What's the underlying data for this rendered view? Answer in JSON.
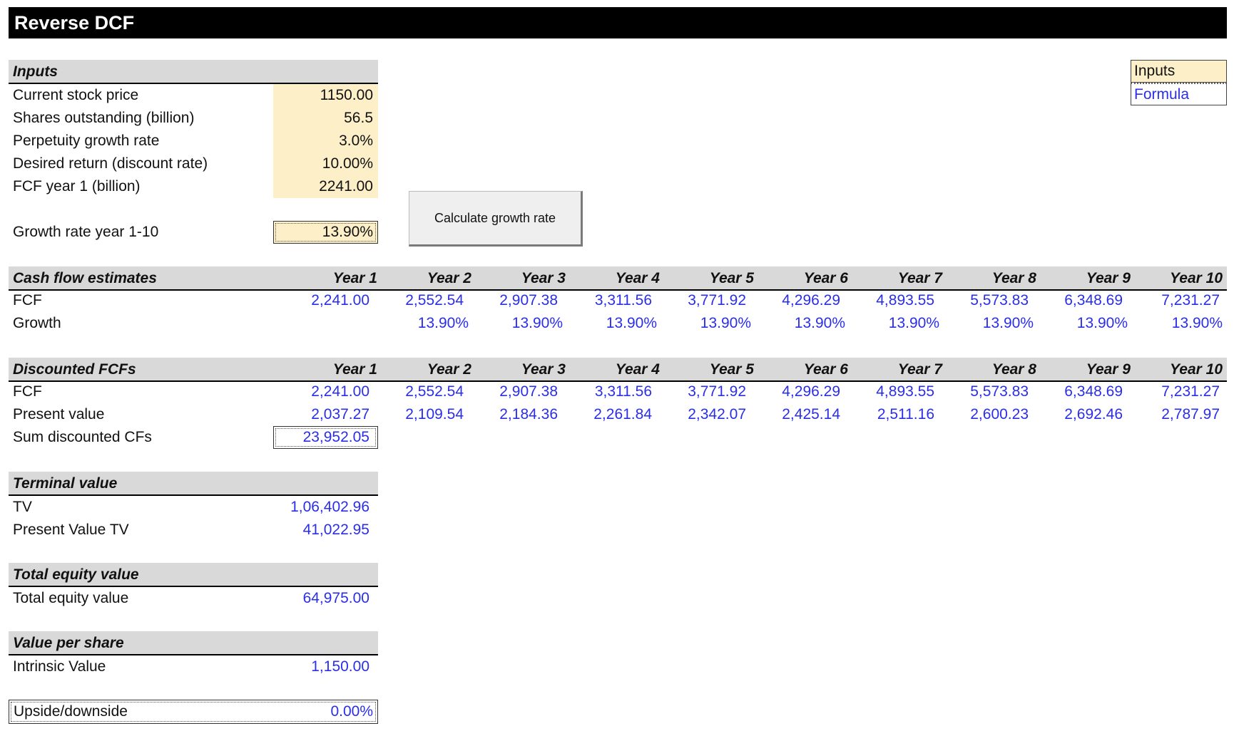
{
  "title": "Reverse DCF",
  "legend": {
    "inputs": "Inputs",
    "formula": "Formula"
  },
  "inputs": {
    "header": "Inputs",
    "rows": [
      {
        "label": "Current stock price",
        "value": "1150.00"
      },
      {
        "label": "Shares outstanding (billion)",
        "value": "56.5"
      },
      {
        "label": "Perpetuity growth rate",
        "value": "3.0%"
      },
      {
        "label": "Desired return (discount rate)",
        "value": "10.00%"
      },
      {
        "label": "FCF year 1 (billion)",
        "value": "2241.00"
      }
    ],
    "growth_label": "Growth rate year 1-10",
    "growth_value": "13.90%"
  },
  "button_label": "Calculate growth rate",
  "years": [
    "Year 1",
    "Year 2",
    "Year 3",
    "Year 4",
    "Year 5",
    "Year 6",
    "Year 7",
    "Year 8",
    "Year 9",
    "Year 10"
  ],
  "cash_flow": {
    "header": "Cash flow estimates",
    "fcf_label": "FCF",
    "fcf": [
      "2,241.00",
      "2,552.54",
      "2,907.38",
      "3,311.56",
      "3,771.92",
      "4,296.29",
      "4,893.55",
      "5,573.83",
      "6,348.69",
      "7,231.27"
    ],
    "growth_label": "Growth",
    "growth": [
      "",
      "13.90%",
      "13.90%",
      "13.90%",
      "13.90%",
      "13.90%",
      "13.90%",
      "13.90%",
      "13.90%",
      "13.90%"
    ]
  },
  "discounted": {
    "header": "Discounted FCFs",
    "fcf_label": "FCF",
    "fcf": [
      "2,241.00",
      "2,552.54",
      "2,907.38",
      "3,311.56",
      "3,771.92",
      "4,296.29",
      "4,893.55",
      "5,573.83",
      "6,348.69",
      "7,231.27"
    ],
    "pv_label": "Present value",
    "pv": [
      "2,037.27",
      "2,109.54",
      "2,184.36",
      "2,261.84",
      "2,342.07",
      "2,425.14",
      "2,511.16",
      "2,600.23",
      "2,692.46",
      "2,787.97"
    ],
    "sum_label": "Sum discounted CFs",
    "sum_value": "23,952.05"
  },
  "terminal": {
    "header": "Terminal value",
    "tv_label": "TV",
    "tv_value": "1,06,402.96",
    "pv_label": "Present Value TV",
    "pv_value": "41,022.95"
  },
  "equity": {
    "header": "Total equity value",
    "label": "Total equity value",
    "value": "64,975.00"
  },
  "per_share": {
    "header": "Value per share",
    "label": "Intrinsic Value",
    "value": "1,150.00"
  },
  "upside": {
    "label": "Upside/downside",
    "value": "0.00%"
  },
  "colors": {
    "input_fill": "#fdefc8",
    "formula_text": "#2a2ee8",
    "header_fill": "#d9d9d9",
    "title_bar": "#000000"
  }
}
